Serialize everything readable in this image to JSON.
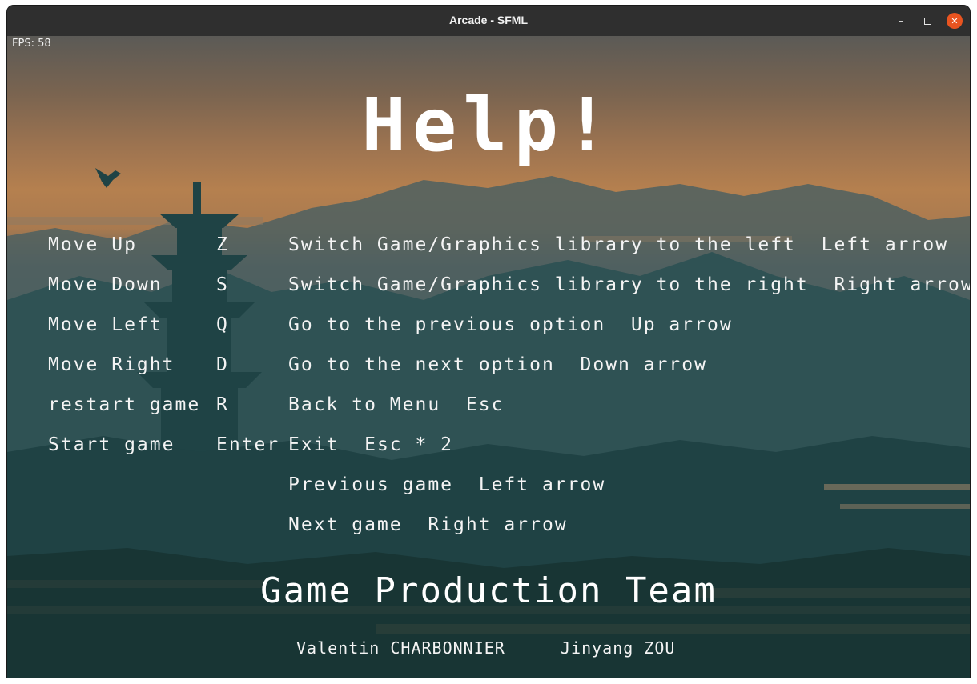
{
  "window": {
    "title": "Arcade - SFML",
    "minimize_glyph": "–",
    "close_glyph": "✕"
  },
  "hud": {
    "fps": "FPS: 58"
  },
  "help": {
    "title": "Help!",
    "game_controls": [
      {
        "action": "Move Up",
        "key": "Z"
      },
      {
        "action": "Move Down",
        "key": "S"
      },
      {
        "action": "Move Left",
        "key": "Q"
      },
      {
        "action": "Move Right",
        "key": "D"
      },
      {
        "action": "restart game",
        "key": "R"
      },
      {
        "action": "Start game",
        "key": "Enter"
      }
    ],
    "global_controls": [
      {
        "action": "Switch Game/Graphics library to the left",
        "key": "Left arrow"
      },
      {
        "action": "Switch Game/Graphics library to the right",
        "key": "Right arrow"
      },
      {
        "action": "Go to the previous option",
        "key": "Up arrow"
      },
      {
        "action": "Go to the next option",
        "key": "Down arrow"
      },
      {
        "action": "Back to Menu",
        "key": "Esc"
      },
      {
        "action": "Exit",
        "key": "Esc * 2"
      },
      {
        "action": "Previous game",
        "key": "Left arrow"
      },
      {
        "action": "Next game",
        "key": "Right arrow"
      }
    ]
  },
  "team": {
    "title": "Game Production Team",
    "members": [
      "Valentin CHARBONNIER",
      "Jinyang ZOU"
    ]
  },
  "colors": {
    "titlebar": "#2f2f2f",
    "close_button": "#e95420",
    "text": "#f4f4f4"
  }
}
